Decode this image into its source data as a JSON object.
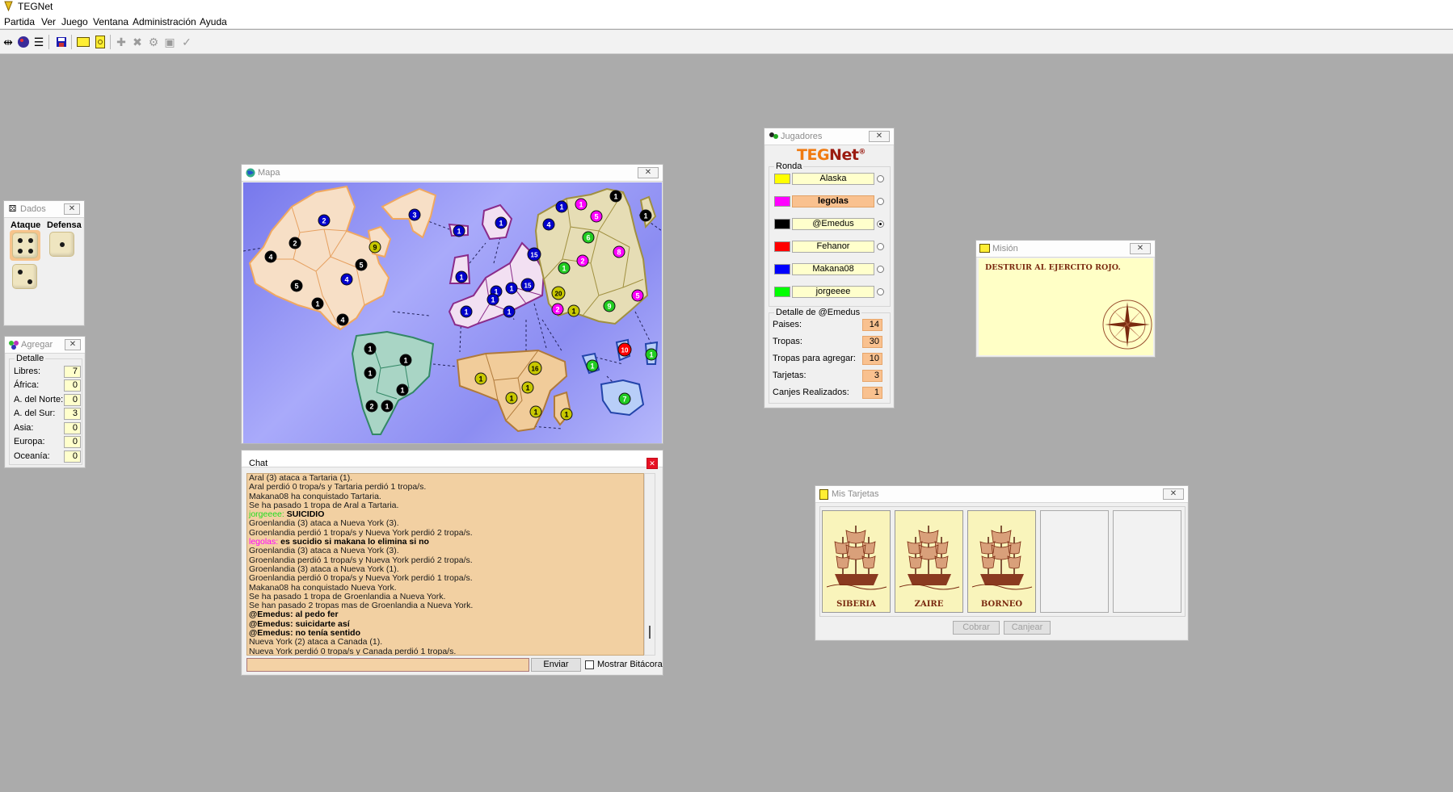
{
  "app": {
    "title": "TEGNet"
  },
  "menu": [
    "Partida",
    "Ver",
    "Juego",
    "Ventana",
    "Administración",
    "Ayuda"
  ],
  "toolbar_icons": [
    "connect-icon",
    "start-game-icon",
    "scores-icon",
    "save-icon",
    "card-icon",
    "mission-icon",
    "add-troops-icon",
    "attack-icon",
    "regroup-icon",
    "card-exchange-icon",
    "end-turn-icon"
  ],
  "dados": {
    "title": "Dados",
    "attack_label": "Ataque",
    "defense_label": "Defensa",
    "attack_dice": [
      4,
      2
    ],
    "defense_dice": [
      1
    ]
  },
  "agregar": {
    "title": "Agregar",
    "legend": "Detalle",
    "rows": [
      {
        "label": "Libres:",
        "value": "7"
      },
      {
        "label": "África:",
        "value": "0"
      },
      {
        "label": "A. del Norte:",
        "value": "0"
      },
      {
        "label": "A. del Sur:",
        "value": "3"
      },
      {
        "label": "Asia:",
        "value": "0"
      },
      {
        "label": "Europa:",
        "value": "0"
      },
      {
        "label": "Oceanía:",
        "value": "0"
      }
    ]
  },
  "mapa": {
    "title": "Mapa",
    "player_colors": {
      "yellow": "#e2e200",
      "magenta": "#ff00ff",
      "black": "#000000",
      "red": "#ff0000",
      "blue": "#0000cc",
      "green": "#22cc22",
      "olive": "#c8c800"
    }
  },
  "chat": {
    "title": "Chat",
    "lines": [
      {
        "text": "Aral (3) ataca a Tartaria (1).",
        "kind": "log"
      },
      {
        "text": "Aral perdió 0 tropa/s y Tartaria perdió 1 tropa/s.",
        "kind": "log"
      },
      {
        "text": "Makana08 ha conquistado Tartaria.",
        "kind": "log"
      },
      {
        "text": "Se ha pasado 1 tropa de Aral a Tartaria.",
        "kind": "log"
      },
      {
        "name": "jorgeeee:",
        "name_color": "#22dd22",
        "text": " SUICIDIO",
        "kind": "msg"
      },
      {
        "text": "Groenlandia (3) ataca a Nueva York (3).",
        "kind": "log"
      },
      {
        "text": "Groenlandia perdió 1 tropa/s y Nueva York perdió 2 tropa/s.",
        "kind": "log"
      },
      {
        "name": "legolas:",
        "name_color": "#ff00ff",
        "text": " es sucidio si makana lo elimina si no",
        "kind": "msg"
      },
      {
        "text": "Groenlandia (3) ataca a Nueva York (3).",
        "kind": "log"
      },
      {
        "text": "Groenlandia perdió 1 tropa/s y Nueva York perdió 2 tropa/s.",
        "kind": "log"
      },
      {
        "text": "Groenlandia (3) ataca a Nueva York (1).",
        "kind": "log"
      },
      {
        "text": "Groenlandia perdió 0 tropa/s y Nueva York perdió 1 tropa/s.",
        "kind": "log"
      },
      {
        "text": "Makana08 ha conquistado Nueva York.",
        "kind": "log"
      },
      {
        "text": "Se ha pasado 1 tropa de Groenlandia a Nueva York.",
        "kind": "log"
      },
      {
        "text": "Se han pasado 2 tropas mas de Groenlandia a Nueva York.",
        "kind": "log"
      },
      {
        "name": "@Emedus:",
        "name_color": "#000000",
        "text": " al pedo fer",
        "kind": "msg"
      },
      {
        "name": "@Emedus:",
        "name_color": "#000000",
        "text": " suicidarte así",
        "kind": "msg"
      },
      {
        "name": "@Emedus:",
        "name_color": "#000000",
        "text": " no tenía sentido",
        "kind": "msg"
      },
      {
        "text": "Nueva York (2) ataca a Canada (1).",
        "kind": "log"
      },
      {
        "text": "Nueva York perdió 0 tropa/s y Canada perdió 1 tropa/s.",
        "kind": "log"
      }
    ],
    "input_value": "",
    "send_label": "Enviar",
    "show_log_label": "Mostrar Bitácora"
  },
  "jugadores": {
    "title": "Jugadores",
    "logo_teg": "TEG",
    "logo_net": "Net",
    "logo_reg": "®",
    "round_legend": "Ronda",
    "players": [
      {
        "name": "Alaska",
        "color": "#ffff00",
        "turn": false,
        "selected": false
      },
      {
        "name": "legolas",
        "color": "#ff00ff",
        "turn": true,
        "selected": false
      },
      {
        "name": "@Emedus",
        "color": "#000000",
        "turn": false,
        "selected": true
      },
      {
        "name": "Fehanor",
        "color": "#ff0000",
        "turn": false,
        "selected": false
      },
      {
        "name": "Makana08",
        "color": "#0000ff",
        "turn": false,
        "selected": false
      },
      {
        "name": "jorgeeee",
        "color": "#00ff00",
        "turn": false,
        "selected": false
      }
    ],
    "detail_legend": "Detalle de @Emedus",
    "details": [
      {
        "label": "Paises:",
        "value": "14"
      },
      {
        "label": "Tropas:",
        "value": "30"
      },
      {
        "label": "Tropas para agregar:",
        "value": "10"
      },
      {
        "label": "Tarjetas:",
        "value": "3"
      },
      {
        "label": "Canjes Realizados:",
        "value": "1"
      }
    ]
  },
  "mision": {
    "title": "Misión",
    "text": "DESTRUIR AL EJERCITO ROJO."
  },
  "tarjetas": {
    "title": "Mis Tarjetas",
    "cards": [
      "SIBERIA",
      "ZAIRE",
      "BORNEO"
    ],
    "empty_slots": 2,
    "collect_label": "Cobrar",
    "exchange_label": "Canjear"
  }
}
